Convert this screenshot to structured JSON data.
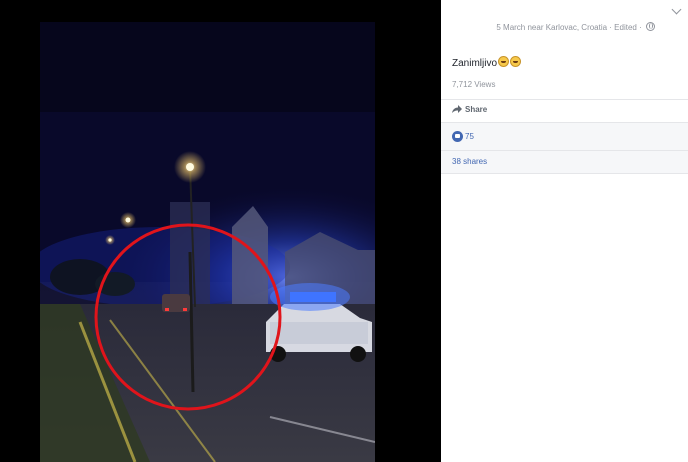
{
  "post": {
    "meta": "5 March near Karlovac, Croatia · Edited ·",
    "text": "Zanimljivo",
    "views": "7,712 Views",
    "share_label": "Share",
    "likes_count": "75",
    "shares_label": "38 shares"
  },
  "colors": {
    "link": "#4267b2",
    "muted": "#90949c",
    "annotation_circle": "#e0141b",
    "police_light": "#3a6dff"
  },
  "icons": [
    "globe-icon",
    "chevron-down-icon",
    "share-icon",
    "like-icon",
    "emoji-icon"
  ]
}
